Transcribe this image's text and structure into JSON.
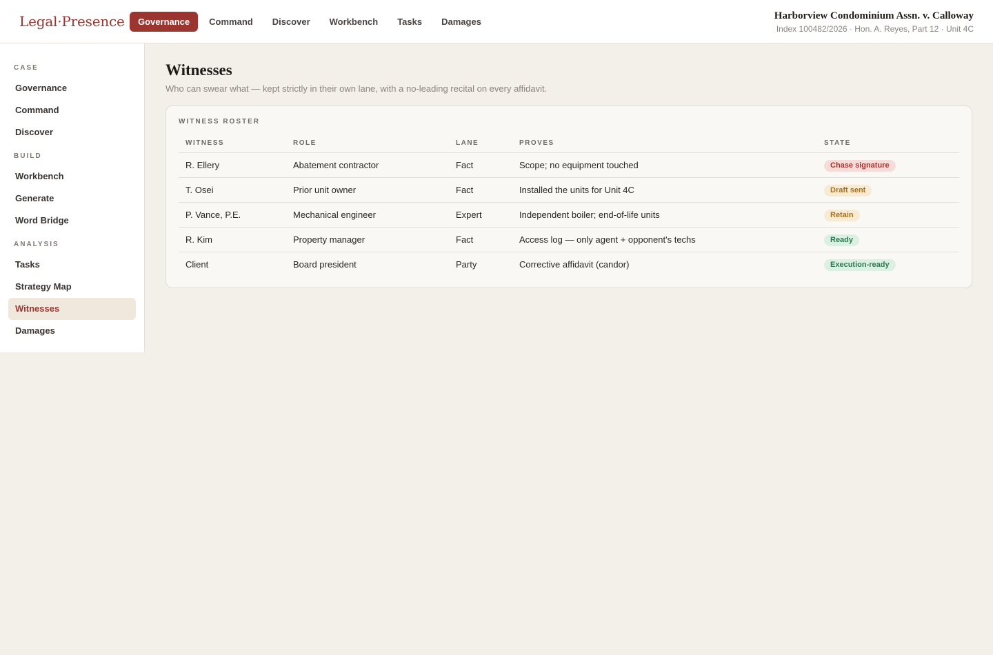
{
  "brand": {
    "left": "Legal",
    "dot": "·",
    "right": "Presence"
  },
  "topnav": [
    "Governance",
    "Command",
    "Discover",
    "Workbench",
    "Tasks",
    "Damages"
  ],
  "case": {
    "title": "Harborview Condominium Assn. v. Calloway",
    "subtitle": "Index 100482/2026 · Hon. A. Reyes, Part 12 · Unit 4C"
  },
  "sidebar": {
    "sections": [
      {
        "label": "CASE",
        "items": [
          "Governance",
          "Command",
          "Discover"
        ]
      },
      {
        "label": "BUILD",
        "items": [
          "Workbench",
          "Generate",
          "Word Bridge"
        ]
      },
      {
        "label": "ANALYSIS",
        "items": [
          "Tasks",
          "Strategy Map",
          "Witnesses",
          "Damages"
        ]
      }
    ],
    "active": "Witnesses"
  },
  "page": {
    "title": "Witnesses",
    "subtitle": "Who can swear what — kept strictly in their own lane, with a no-leading recital on every affidavit."
  },
  "roster": {
    "label": "WITNESS ROSTER",
    "columns": [
      "WITNESS",
      "ROLE",
      "LANE",
      "PROVES",
      "STATE"
    ],
    "rows": [
      {
        "witness": "R. Ellery",
        "role": "Abatement contractor",
        "lane": "Fact",
        "proves": "Scope; no equipment touched",
        "state": "Chase signature",
        "tone": "red"
      },
      {
        "witness": "T. Osei",
        "role": "Prior unit owner",
        "lane": "Fact",
        "proves": "Installed the units for Unit 4C",
        "state": "Draft sent",
        "tone": "amber"
      },
      {
        "witness": "P. Vance, P.E.",
        "role": "Mechanical engineer",
        "lane": "Expert",
        "proves": "Independent boiler; end-of-life units",
        "state": "Retain",
        "tone": "amber"
      },
      {
        "witness": "R. Kim",
        "role": "Property manager",
        "lane": "Fact",
        "proves": "Access log — only agent + opponent's techs",
        "state": "Ready",
        "tone": "green"
      },
      {
        "witness": "Client",
        "role": "Board president",
        "lane": "Party",
        "proves": "Corrective affidavit (candor)",
        "state": "Execution-ready",
        "tone": "green"
      }
    ]
  },
  "colors": {
    "accent": "#9a3530",
    "badge_red": "#a8322c",
    "badge_amber": "#a8701a",
    "badge_green": "#2c7a4f"
  }
}
